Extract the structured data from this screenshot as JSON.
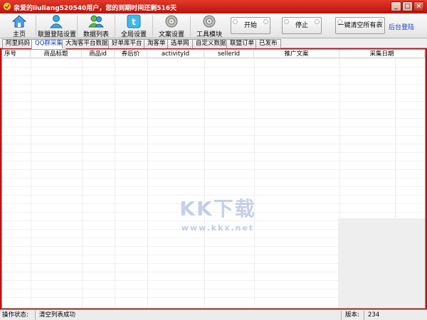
{
  "window": {
    "title": "亲爱的liuliang520540用户，您的到期时间还剩516天"
  },
  "toolbar": {
    "tools": [
      "主页",
      "联盟登陆设置",
      "数据列表",
      "全局设置",
      "文案设置",
      "工具模块"
    ],
    "start_label": "开始",
    "stop_label": "停止",
    "clear_label": "一键清空所有表",
    "backend_link": "后台登陆"
  },
  "tabs": [
    "阿里妈妈",
    "QQ群采集",
    "大淘客平台数据",
    "好单库平台",
    "淘客单",
    "选单网",
    "自定义数据",
    "联盟订单",
    "已发布"
  ],
  "table": {
    "columns": [
      "序号",
      "商品标题",
      "商品id",
      "券后价",
      "activityId",
      "sellerId",
      "推广文案",
      "采集日期"
    ]
  },
  "watermark": {
    "big": "KK下载",
    "small": "www.kkx.net"
  },
  "status": {
    "label": "操作状态:",
    "message": "清空列表成功",
    "version_label": "版本:",
    "version": "234"
  },
  "colors": {
    "titlebar": "#c21010",
    "active_tab_text": "#1a3fbf",
    "link": "#1a3fbf"
  }
}
